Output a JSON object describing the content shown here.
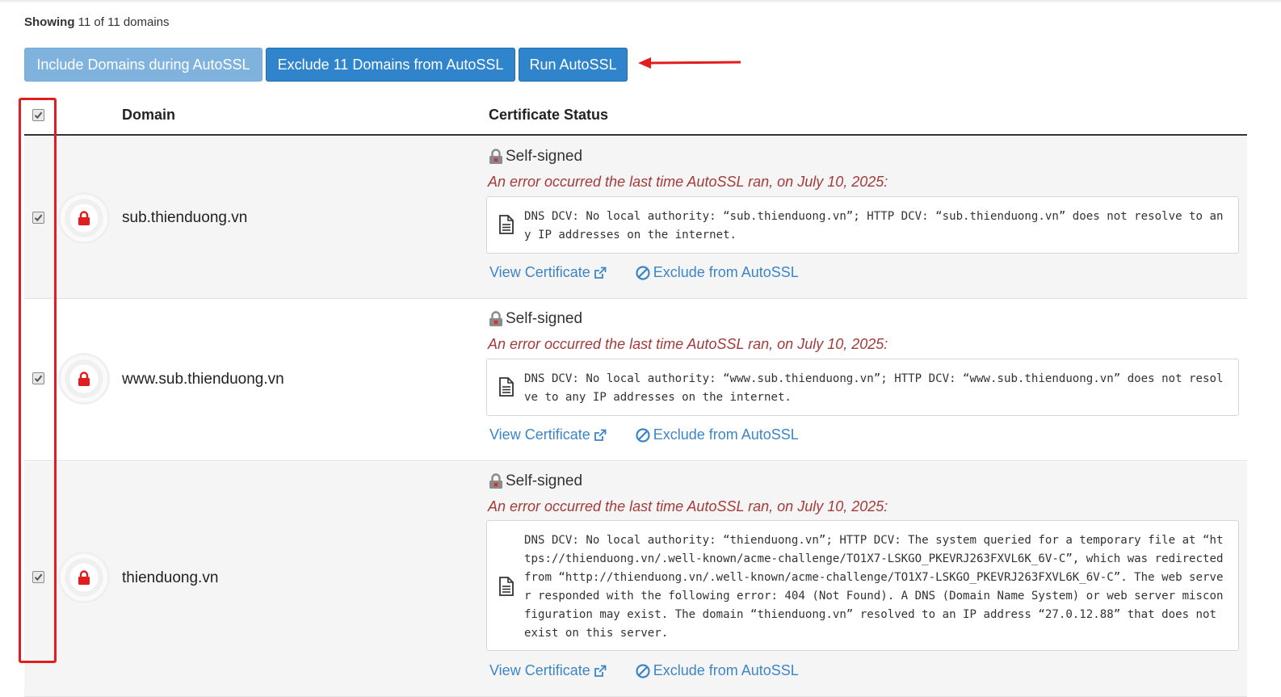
{
  "summary": {
    "showing_label": "Showing",
    "showing_count": "11 of 11 domains"
  },
  "toolbar": {
    "include_label": "Include Domains during AutoSSL",
    "exclude_label": "Exclude 11 Domains from AutoSSL",
    "run_label": "Run AutoSSL"
  },
  "table": {
    "headers": {
      "domain": "Domain",
      "status": "Certificate Status"
    },
    "select_all_checked": true,
    "rows": [
      {
        "domain": "sub.thienduong.vn",
        "checked": true,
        "status": "Self-signed",
        "error_heading": "An error occurred the last time AutoSSL ran, on July 10, 2025:",
        "error_detail": "DNS DCV: No local authority: “sub.thienduong.vn”; HTTP DCV: “sub.thienduong.vn” does not resolve to any IP addresses on the internet.",
        "view_label": "View Certificate",
        "exclude_label": "Exclude from AutoSSL"
      },
      {
        "domain": "www.sub.thienduong.vn",
        "checked": true,
        "status": "Self-signed",
        "error_heading": "An error occurred the last time AutoSSL ran, on July 10, 2025:",
        "error_detail": "DNS DCV: No local authority: “www.sub.thienduong.vn”; HTTP DCV: “www.sub.thienduong.vn” does not resolve to any IP addresses on the internet.",
        "view_label": "View Certificate",
        "exclude_label": "Exclude from AutoSSL"
      },
      {
        "domain": "thienduong.vn",
        "checked": true,
        "status": "Self-signed",
        "error_heading": "An error occurred the last time AutoSSL ran, on July 10, 2025:",
        "error_detail": "DNS DCV: No local authority: “thienduong.vn”; HTTP DCV: The system queried for a temporary file at “https://thienduong.vn/.well-known/acme-challenge/TO1X7-LSKGO_PKEVRJ263FXVL6K_6V-C”, which was redirected from “http://thienduong.vn/.well-known/acme-challenge/TO1X7-LSKGO_PKEVRJ263FXVL6K_6V-C”. The web server responded with the following error: 404 (Not Found). A DNS (Domain Name System) or web server misconfiguration may exist. The domain “thienduong.vn” resolved to an IP address “27.0.12.88” that does not exist on this server.",
        "view_label": "View Certificate",
        "exclude_label": "Exclude from AutoSSL"
      }
    ]
  },
  "icons": {
    "lock": "lock-icon",
    "self_signed": "self-signed-lock-icon",
    "document": "document-icon",
    "external_link": "external-link-icon",
    "ban": "ban-icon"
  },
  "colors": {
    "primary_button": "#2f84cc",
    "disabled_button": "#7fb3de",
    "error_text": "#a33b3b",
    "link": "#3d85c6",
    "lock_red": "#e21d1d",
    "annotation_red": "#e21d1d"
  }
}
